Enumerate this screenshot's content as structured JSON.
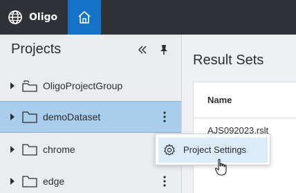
{
  "app": {
    "name": "Oligo"
  },
  "colors": {
    "topbar": "#2f3237",
    "accent": "#1473c9",
    "selected_row": "#a9cdeb",
    "menu_hover": "#dcebf8"
  },
  "icons": {
    "brand": "globe-icon",
    "home": "home-icon",
    "collapse": "double-chevron-left-icon",
    "pin": "pin-icon",
    "folder": "folder-icon",
    "more": "kebab-icon",
    "settings": "gear-icon",
    "cursor": "hand-pointer-icon"
  },
  "sidebar": {
    "title": "Projects",
    "items": [
      {
        "label": "OligoProjectGroup",
        "type": "group",
        "selected": false
      },
      {
        "label": "demoDataset",
        "type": "project",
        "selected": true
      },
      {
        "label": "chrome",
        "type": "project",
        "selected": false
      },
      {
        "label": "edge",
        "type": "project",
        "selected": false
      }
    ]
  },
  "main": {
    "title": "Result Sets",
    "table": {
      "columns": [
        "Name"
      ],
      "rows": [
        [
          "AJS092023.rslt"
        ]
      ]
    }
  },
  "context_menu": {
    "items": [
      {
        "label": "Project Settings"
      }
    ]
  }
}
